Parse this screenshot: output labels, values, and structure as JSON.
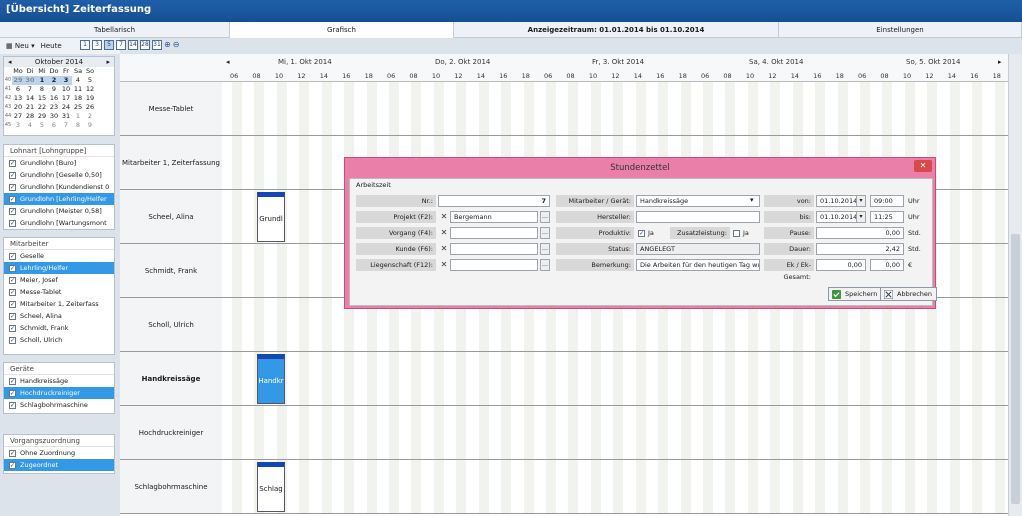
{
  "window": {
    "title": "[Übersicht] Zeiterfassung"
  },
  "tabs": [
    {
      "label": "Tabellarisch"
    },
    {
      "label": "Grafisch"
    },
    {
      "label": "Anzeigezeitraum: 01.01.2014 bis 01.10.2014"
    },
    {
      "label": "Einstellungen"
    }
  ],
  "toolbar": {
    "new_label": "Neu",
    "today_label": "Heute",
    "views": [
      "1",
      "3",
      "5",
      "7",
      "14",
      "28",
      "31"
    ]
  },
  "calendar": {
    "month": "Oktober 2014",
    "weekdays": [
      "Mo",
      "Di",
      "Mi",
      "Do",
      "Fr",
      "Sa",
      "So"
    ],
    "weeks": [
      {
        "wk": "40",
        "days": [
          "29",
          "30",
          "1",
          "2",
          "3",
          "4",
          "5"
        ]
      },
      {
        "wk": "41",
        "days": [
          "6",
          "7",
          "8",
          "9",
          "10",
          "11",
          "12"
        ]
      },
      {
        "wk": "42",
        "days": [
          "13",
          "14",
          "15",
          "16",
          "17",
          "18",
          "19"
        ]
      },
      {
        "wk": "43",
        "days": [
          "20",
          "21",
          "22",
          "23",
          "24",
          "25",
          "26"
        ]
      },
      {
        "wk": "44",
        "days": [
          "27",
          "28",
          "29",
          "30",
          "31",
          "1",
          "2"
        ]
      },
      {
        "wk": "45",
        "days": [
          "3",
          "4",
          "5",
          "6",
          "7",
          "8",
          "9"
        ]
      }
    ]
  },
  "lohnart": {
    "title": "Lohnart [Lohngruppe]",
    "items": [
      {
        "label": "Grundlohn [Buro]",
        "sel": false
      },
      {
        "label": "Grundlohn [Geselle 0,50]",
        "sel": false
      },
      {
        "label": "Grundlohn [Kundendienst 0",
        "sel": false
      },
      {
        "label": "Grundlohn [Lehrling/Helfer",
        "sel": true
      },
      {
        "label": "Grundlohn [Meister 0,58]",
        "sel": false
      },
      {
        "label": "Grundlohn [Wartungsmont",
        "sel": false
      }
    ]
  },
  "mitarbeiter": {
    "title": "Mitarbeiter",
    "items": [
      {
        "label": "Geselle",
        "sel": false
      },
      {
        "label": "Lehrling/Helfer",
        "sel": true
      },
      {
        "label": "Meier, Josef",
        "sel": false
      },
      {
        "label": "Messe-Tablet",
        "sel": false
      },
      {
        "label": "Mitarbeiter 1, Zeiterfass",
        "sel": false
      },
      {
        "label": "Scheel, Alina",
        "sel": false
      },
      {
        "label": "Schmidt, Frank",
        "sel": false
      },
      {
        "label": "Scholl, Ulrich",
        "sel": false
      }
    ]
  },
  "geraete": {
    "title": "Geräte",
    "items": [
      {
        "label": "Handkreissäge",
        "sel": false
      },
      {
        "label": "Hochdruckreiniger",
        "sel": true
      },
      {
        "label": "Schlagbohrmaschine",
        "sel": false
      }
    ]
  },
  "vorgang": {
    "title": "Vorgangszuordnung",
    "items": [
      {
        "label": "Ohne Zuordnung",
        "sel": false
      },
      {
        "label": "Zugeordnet",
        "sel": true
      }
    ]
  },
  "schedule": {
    "days": [
      "Mi, 1. Okt 2014",
      "Do, 2. Okt 2014",
      "Fr, 3. Okt 2014",
      "Sa, 4. Okt 2014",
      "So, 5. Okt 2014"
    ],
    "hours": [
      "06",
      "08",
      "10",
      "12",
      "14",
      "16",
      "18"
    ],
    "rows": [
      {
        "label": "Messe-Tablet",
        "bold": false
      },
      {
        "label": "Mitarbeiter 1, Zeiterfassung",
        "bold": false
      },
      {
        "label": "Scheel, Alina",
        "bold": false
      },
      {
        "label": "Schmidt, Frank",
        "bold": false
      },
      {
        "label": "Scholl, Ulrich",
        "bold": false
      },
      {
        "label": "Handkreissäge",
        "bold": true
      },
      {
        "label": "Hochdruckreiniger",
        "bold": false
      },
      {
        "label": "Schlagbohrmaschine",
        "bold": false
      }
    ],
    "events": [
      {
        "row": 2,
        "label": "Grundl",
        "selected": false
      },
      {
        "row": 5,
        "label": "Handkr",
        "selected": true
      },
      {
        "row": 7,
        "label": "Schlag",
        "selected": false
      }
    ]
  },
  "dialog": {
    "title": "Stundenzettel",
    "section": "Arbeitszeit",
    "nr_label": "Nr.:",
    "nr_value": "7",
    "projekt_label": "Projekt (F2):",
    "projekt_value": "Bergemann",
    "vorgang_label": "Vorgang (F4):",
    "vorgang_value": "",
    "kunde_label": "Kunde (F6):",
    "kunde_value": "",
    "liegenschaft_label": "Liegenschaft (F12):",
    "liegenschaft_value": "",
    "mitarbeiter_label": "Mitarbeiter / Gerät:",
    "mitarbeiter_value": "Handkreissäge",
    "hersteller_label": "Hersteller:",
    "hersteller_value": "",
    "produktiv_label": "Produktiv:",
    "produktiv_value": "Ja",
    "zusatz_label": "Zusatzleistung:",
    "zusatz_value": "Ja",
    "status_label": "Status:",
    "status_value": "ANGELEGT",
    "bemerkung_label": "Bemerkung:",
    "bemerkung_value": "Die Arbeiten für den heutigen Tag wur",
    "von_label": "von:",
    "von_date": "01.10.2014",
    "von_time": "09:00",
    "bis_label": "bis:",
    "bis_date": "01.10.2014",
    "bis_time": "11:25",
    "pause_label": "Pause:",
    "pause_value": "0,00",
    "dauer_label": "Dauer:",
    "dauer_value": "2,42",
    "ek_label": "Ek / Ek-Gesamt:",
    "ek_value1": "0,00",
    "ek_value2": "0,00",
    "uhr": "Uhr",
    "std": "Std.",
    "euro": "€",
    "save_label": "Speichern",
    "cancel_label": "Abbrechen"
  }
}
